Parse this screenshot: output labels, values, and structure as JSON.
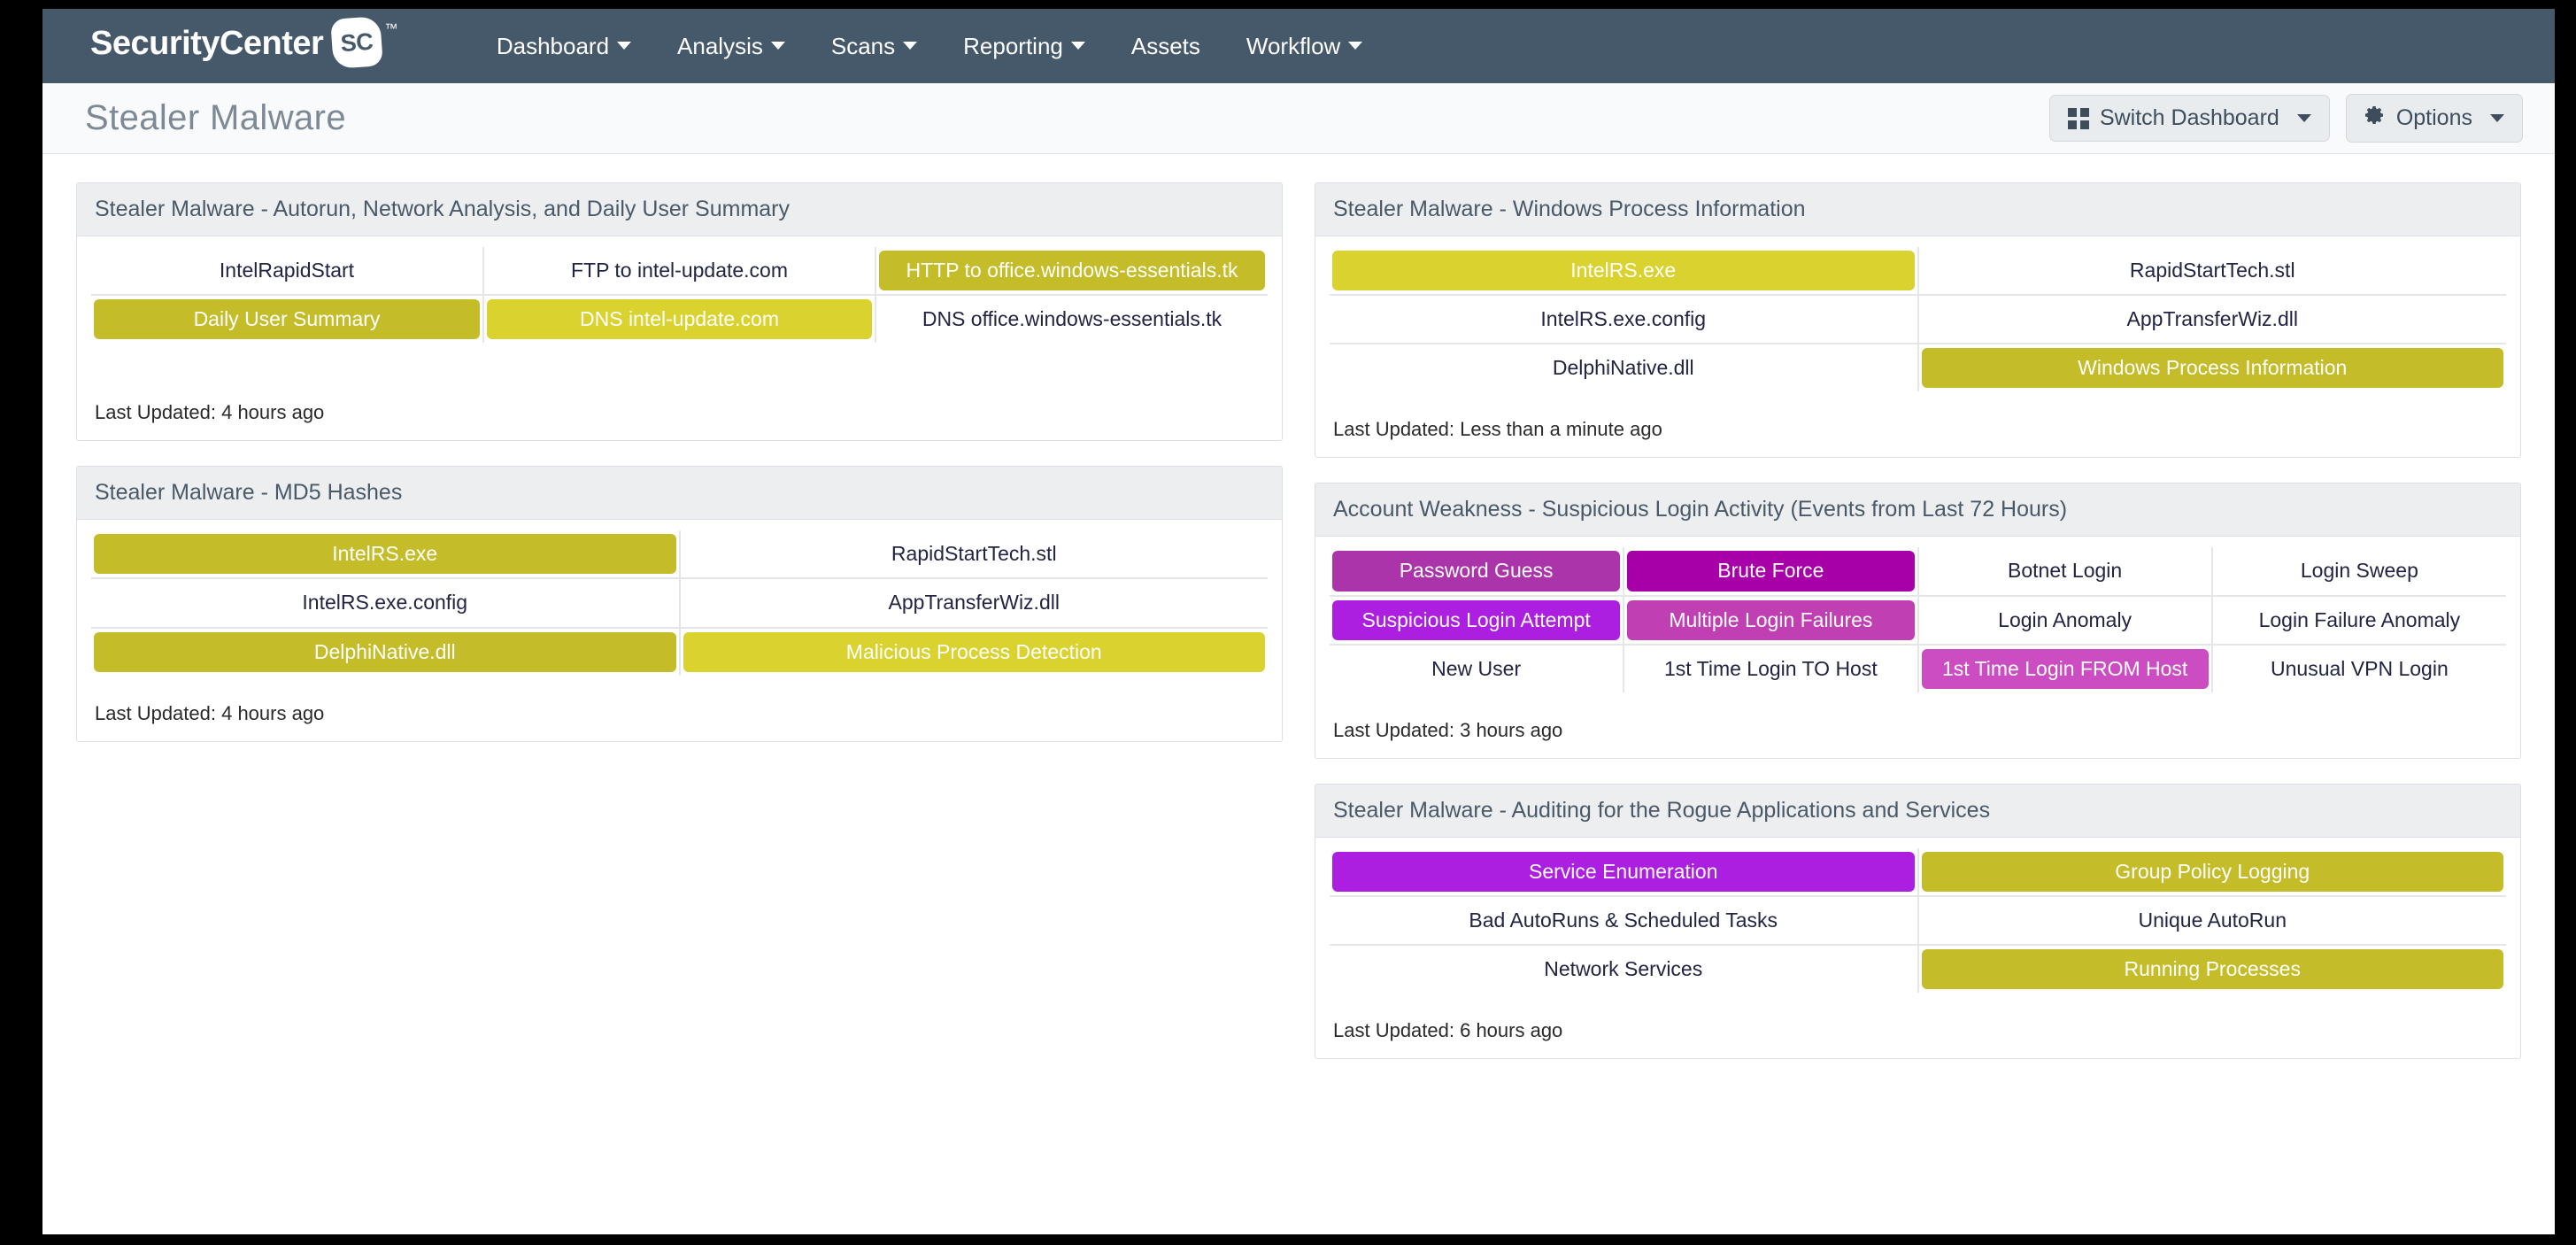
{
  "colors": {
    "nav_bg": "#46596b",
    "olive": "#c4bc28",
    "yellow": "#d9d22f",
    "purple_mid": "#ab34ab",
    "magenta_deep": "#a800a8",
    "violet_bright": "#ad1fe0",
    "pink_purple": "#c040b4",
    "orchid": "#cc4cc2",
    "text_navy": "#232344"
  },
  "topnav": {
    "brand_name": "SecurityCenter",
    "brand_badge": "SC",
    "brand_tm": "™",
    "items": [
      {
        "label": "Dashboard",
        "caret": true
      },
      {
        "label": "Analysis",
        "caret": true
      },
      {
        "label": "Scans",
        "caret": true
      },
      {
        "label": "Reporting",
        "caret": true
      },
      {
        "label": "Assets",
        "caret": false
      },
      {
        "label": "Workflow",
        "caret": true
      }
    ]
  },
  "pagehead": {
    "title": "Stealer Malware",
    "switch_dashboard_label": "Switch Dashboard",
    "options_label": "Options"
  },
  "panels": [
    {
      "id": "autorun-network-daily-user-summary",
      "title": "Stealer Malware - Autorun, Network Analysis, and Daily User Summary",
      "last_updated": "Last Updated: 4 hours ago",
      "columns": 3,
      "rows": [
        [
          {
            "label": "IntelRapidStart",
            "fill": "none"
          },
          {
            "label": "FTP to intel-update.com",
            "fill": "none"
          },
          {
            "label": "HTTP to office.windows-essentials.tk",
            "fill": "olive"
          }
        ],
        [
          {
            "label": "Daily User Summary",
            "fill": "olive"
          },
          {
            "label": "DNS intel-update.com",
            "fill": "yellow"
          },
          {
            "label": "DNS office.windows-essentials.tk",
            "fill": "none"
          }
        ]
      ]
    },
    {
      "id": "md5-hashes",
      "title": "Stealer Malware - MD5 Hashes",
      "last_updated": "Last Updated: 4 hours ago",
      "columns": 2,
      "rows": [
        [
          {
            "label": "IntelRS.exe",
            "fill": "olive"
          },
          {
            "label": "RapidStartTech.stl",
            "fill": "none"
          }
        ],
        [
          {
            "label": "IntelRS.exe.config",
            "fill": "none"
          },
          {
            "label": "AppTransferWiz.dll",
            "fill": "none"
          }
        ],
        [
          {
            "label": "DelphiNative.dll",
            "fill": "olive"
          },
          {
            "label": "Malicious Process Detection",
            "fill": "yellow"
          }
        ]
      ]
    },
    {
      "id": "windows-process-information",
      "title": "Stealer Malware - Windows Process Information",
      "last_updated": "Last Updated: Less than a minute ago",
      "columns": 2,
      "rows": [
        [
          {
            "label": "IntelRS.exe",
            "fill": "yellow"
          },
          {
            "label": "RapidStartTech.stl",
            "fill": "none"
          }
        ],
        [
          {
            "label": "IntelRS.exe.config",
            "fill": "none"
          },
          {
            "label": "AppTransferWiz.dll",
            "fill": "none"
          }
        ],
        [
          {
            "label": "DelphiNative.dll",
            "fill": "none"
          },
          {
            "label": "Windows Process Information",
            "fill": "olive"
          }
        ]
      ]
    },
    {
      "id": "account-weakness-suspicious-login-activity",
      "title": "Account Weakness - Suspicious Login Activity (Events from Last 72 Hours)",
      "last_updated": "Last Updated: 3 hours ago",
      "columns": 4,
      "rows": [
        [
          {
            "label": "Password Guess",
            "fill": "purple_mid"
          },
          {
            "label": "Brute Force",
            "fill": "magenta_deep"
          },
          {
            "label": "Botnet Login",
            "fill": "none"
          },
          {
            "label": "Login Sweep",
            "fill": "none"
          }
        ],
        [
          {
            "label": "Suspicious Login Attempt",
            "fill": "violet_bright"
          },
          {
            "label": "Multiple Login Failures",
            "fill": "pink_purple"
          },
          {
            "label": "Login Anomaly",
            "fill": "none"
          },
          {
            "label": "Login Failure Anomaly",
            "fill": "none"
          }
        ],
        [
          {
            "label": "New User",
            "fill": "none"
          },
          {
            "label": "1st Time Login TO Host",
            "fill": "none"
          },
          {
            "label": "1st Time Login FROM Host",
            "fill": "orchid"
          },
          {
            "label": "Unusual VPN Login",
            "fill": "none"
          }
        ]
      ]
    },
    {
      "id": "auditing-rogue-applications-services",
      "title": "Stealer Malware - Auditing for the Rogue Applications and Services",
      "last_updated": "Last Updated: 6 hours ago",
      "columns": 2,
      "rows": [
        [
          {
            "label": "Service Enumeration",
            "fill": "violet_bright"
          },
          {
            "label": "Group Policy Logging",
            "fill": "olive"
          }
        ],
        [
          {
            "label": "Bad AutoRuns & Scheduled Tasks",
            "fill": "none"
          },
          {
            "label": "Unique AutoRun",
            "fill": "none"
          }
        ],
        [
          {
            "label": "Network Services",
            "fill": "none"
          },
          {
            "label": "Running Processes",
            "fill": "olive"
          }
        ]
      ]
    }
  ],
  "layout": {
    "left_column_panels": [
      "autorun-network-daily-user-summary",
      "md5-hashes"
    ],
    "right_column_panels": [
      "windows-process-information",
      "account-weakness-suspicious-login-activity",
      "auditing-rogue-applications-services"
    ]
  }
}
